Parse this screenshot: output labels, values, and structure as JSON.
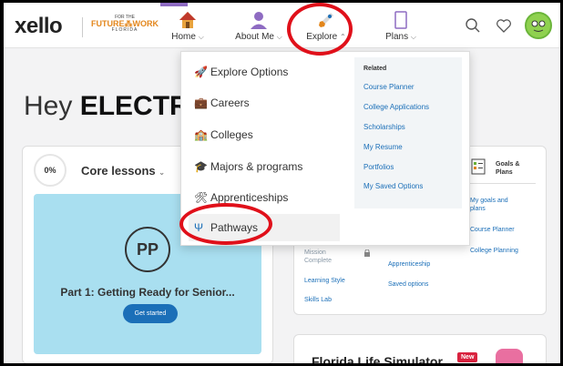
{
  "header": {
    "logo": "xello",
    "partner": {
      "line1": "FOR THE",
      "line2": "FUTURE⁂WORK",
      "line3": "FLORIDA"
    },
    "nav": [
      {
        "label": "Home",
        "icon": "home-icon"
      },
      {
        "label": "About Me",
        "icon": "person-icon"
      },
      {
        "label": "Explore",
        "icon": "rocket-icon"
      },
      {
        "label": "Plans",
        "icon": "clipboard-icon"
      }
    ],
    "icons": [
      "search-icon",
      "heart-icon",
      "avatar"
    ],
    "accent": "#8e6bc2"
  },
  "greeting": {
    "prefix": "Hey",
    "name": "ELECTR"
  },
  "core_card": {
    "percent": "0%",
    "title": "Core lessons",
    "lesson_badge": "PP",
    "lesson_title": "Part 1: Getting Ready for Senior...",
    "button": "Get started"
  },
  "partial_links": {
    "mid_col": [
      "Mission",
      "Complete",
      "Learning Style",
      "Skills Lab"
    ],
    "right_col": [
      "Apprenticeship",
      "Saved options"
    ]
  },
  "goals_card": {
    "title_line1": "Goals &",
    "title_line2": "Plans",
    "links": [
      "My goals and",
      "plans",
      "Course Planner",
      "College Planning"
    ]
  },
  "simulator": {
    "title": "Florida Life Simulator",
    "badge": "New"
  },
  "dropdown": {
    "items": [
      {
        "label": "Explore Options",
        "icon": "rocket-icon",
        "glyph": "🚀"
      },
      {
        "label": "Careers",
        "icon": "briefcase-icon",
        "glyph": "💼"
      },
      {
        "label": "Colleges",
        "icon": "school-icon",
        "glyph": "🏫"
      },
      {
        "label": "Majors & programs",
        "icon": "graduation-cap-icon",
        "glyph": "🎓"
      },
      {
        "label": "Apprenticeships",
        "icon": "tools-icon",
        "glyph": "🛠"
      },
      {
        "label": "Pathways",
        "icon": "pathways-icon",
        "glyph": "Ψ"
      }
    ],
    "related_heading": "Related",
    "related_links": [
      "Course Planner",
      "College Applications",
      "Scholarships",
      "My Resume",
      "Portfolios",
      "My Saved Options"
    ]
  },
  "highlight_color": "#e0101a"
}
